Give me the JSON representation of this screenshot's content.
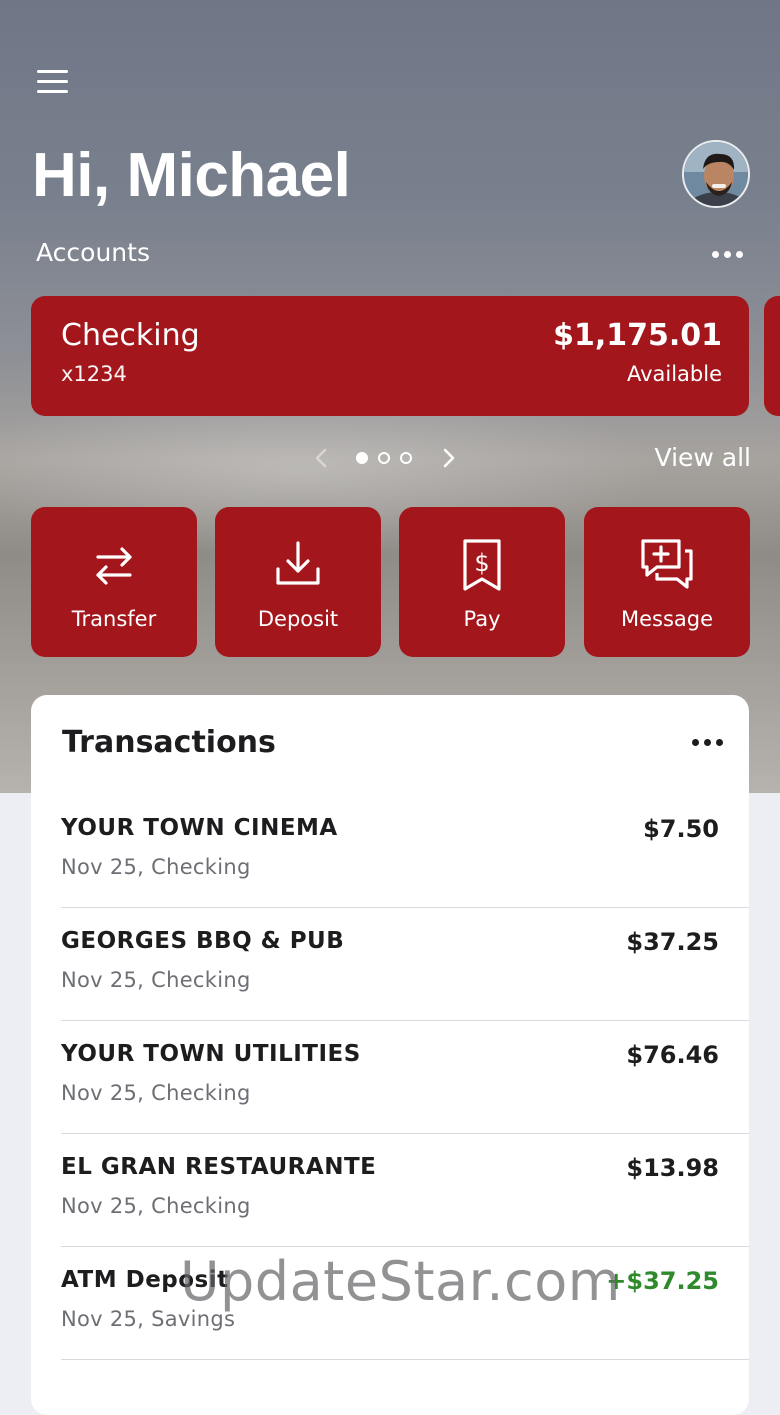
{
  "header": {
    "greeting": "Hi, Michael",
    "accounts_label": "Accounts"
  },
  "account_card": {
    "name": "Checking",
    "number": "x1234",
    "balance": "$1,175.01",
    "balance_label": "Available"
  },
  "pager": {
    "pages": 3,
    "active_index": 0,
    "view_all": "View all"
  },
  "actions": [
    {
      "label": "Transfer",
      "icon": "transfer-icon"
    },
    {
      "label": "Deposit",
      "icon": "deposit-icon"
    },
    {
      "label": "Pay",
      "icon": "pay-bill-icon"
    },
    {
      "label": "Message",
      "icon": "message-icon"
    }
  ],
  "transactions": {
    "title": "Transactions",
    "items": [
      {
        "name": "YOUR TOWN CINEMA",
        "sub": "Nov 25, Checking",
        "amount": "$7.50",
        "credit": false
      },
      {
        "name": "GEORGES BBQ & PUB",
        "sub": "Nov 25, Checking",
        "amount": "$37.25",
        "credit": false
      },
      {
        "name": "YOUR TOWN UTILITIES",
        "sub": "Nov 25, Checking",
        "amount": "$76.46",
        "credit": false
      },
      {
        "name": "EL GRAN RESTAURANTE",
        "sub": "Nov 25, Checking",
        "amount": "$13.98",
        "credit": false
      },
      {
        "name": "ATM Deposit",
        "sub": "Nov 25, Savings",
        "amount": "+$37.25",
        "credit": true
      }
    ]
  },
  "watermark": "UpdateStar.com",
  "colors": {
    "brand_red": "#a3161c",
    "credit_green": "#2f8a2c"
  }
}
